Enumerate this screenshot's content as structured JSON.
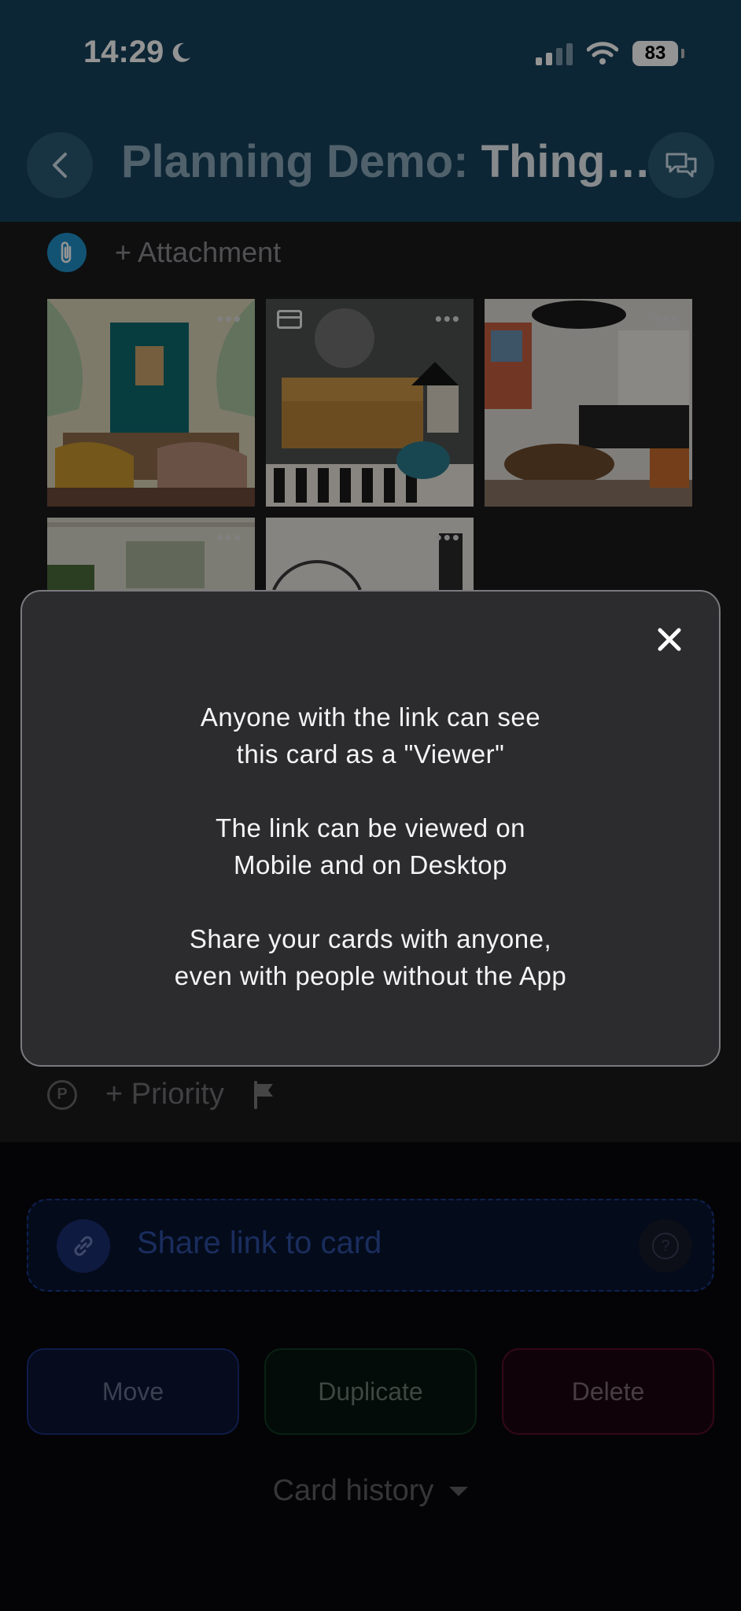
{
  "status_bar": {
    "time": "14:29",
    "battery": "83"
  },
  "header": {
    "title_prefix": "Planning Demo: ",
    "title_main": "Thing…"
  },
  "attachments": {
    "add_label": "+ Attachment",
    "thumbs": [
      {
        "name": "teal-living-room-photo",
        "has_more": true,
        "has_card_icon": false
      },
      {
        "name": "gray-living-room-photo",
        "has_more": true,
        "has_card_icon": true
      },
      {
        "name": "white-living-room-photo",
        "has_more": true,
        "has_card_icon": false
      },
      {
        "name": "garden-room-photo",
        "has_more": true,
        "has_card_icon": false
      },
      {
        "name": "mirror-room-photo",
        "has_more": true,
        "has_card_icon": false
      }
    ]
  },
  "priority": {
    "badge": "P",
    "label": "+ Priority"
  },
  "share": {
    "label": "Share link to card",
    "help": "?"
  },
  "actions": {
    "move": "Move",
    "duplicate": "Duplicate",
    "delete": "Delete"
  },
  "history": {
    "label": "Card history"
  },
  "modal": {
    "line1a": "Anyone with the link can see",
    "line1b": "this card as a \"Viewer\"",
    "line2a": "The link can be viewed on",
    "line2b": "Mobile and on Desktop",
    "line3a": "Share your cards with anyone,",
    "line3b": "even with people without the App"
  },
  "colors": {
    "header": "#17425c",
    "accent_blue": "#1f8fc7",
    "move": "#1b2f7d",
    "duplicate": "#103a22",
    "delete": "#5a0f26"
  }
}
